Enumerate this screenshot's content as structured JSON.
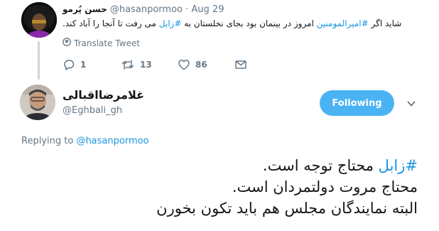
{
  "parent_tweet": {
    "display_name": "حسن پُرمو",
    "handle": "@hasanpormoo",
    "separator": "·",
    "date": "Aug 29",
    "text_parts": {
      "p1": "شاید اگر ",
      "h1": "#امیرالمومنین",
      "p2": " امروز در بینمان بود بجای نخلستان به ",
      "h2": "#زابل",
      "p3": " می رفت تا آنجا را آباد کند."
    },
    "translate_label": "Translate Tweet",
    "reply_count": "1",
    "retweet_count": "13",
    "like_count": "86"
  },
  "main_tweet": {
    "display_name": "غلامرضااقبالی",
    "handle": "@Eghbali_gh",
    "follow_label": "Following",
    "replying_prefix": "Replying to",
    "replying_handle": "@hasanpormoo",
    "line1_hashtag": "#زابل",
    "line1_rest": " محتاج توجه است.",
    "line2": "محتاج مروت دولتمردان است.",
    "line3": "البته نمایندگان مجلس هم باید تکون بخورن"
  },
  "colors": {
    "accent": "#1b95e0",
    "follow_button": "#4ab3f4",
    "muted": "#657786"
  }
}
